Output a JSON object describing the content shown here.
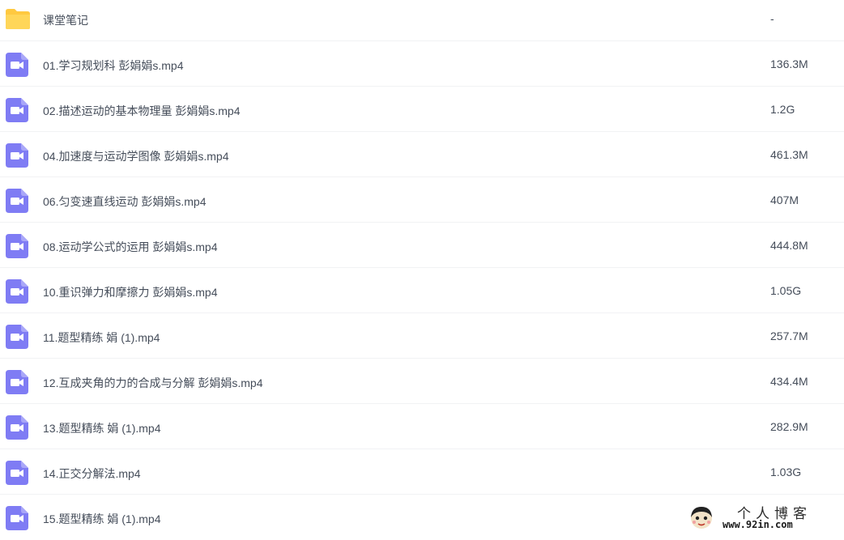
{
  "colors": {
    "folder_icon": "#ffd659",
    "video_icon": "#7f7cf4",
    "text": "#454d5a",
    "row_divider": "#f1f2f4"
  },
  "files": [
    {
      "type": "folder",
      "icon": "folder-icon",
      "name": "课堂笔记",
      "size": "-"
    },
    {
      "type": "video",
      "icon": "video-file-icon",
      "name": "01.学习规划科 彭娟娟s.mp4",
      "size": "136.3M"
    },
    {
      "type": "video",
      "icon": "video-file-icon",
      "name": "02.描述运动的基本物理量 彭娟娟s.mp4",
      "size": "1.2G"
    },
    {
      "type": "video",
      "icon": "video-file-icon",
      "name": "04.加速度与运动学图像 彭娟娟s.mp4",
      "size": "461.3M"
    },
    {
      "type": "video",
      "icon": "video-file-icon",
      "name": "06.匀变速直线运动 彭娟娟s.mp4",
      "size": "407M"
    },
    {
      "type": "video",
      "icon": "video-file-icon",
      "name": "08.运动学公式的运用 彭娟娟s.mp4",
      "size": "444.8M"
    },
    {
      "type": "video",
      "icon": "video-file-icon",
      "name": "10.重识弹力和摩擦力 彭娟娟s.mp4",
      "size": "1.05G"
    },
    {
      "type": "video",
      "icon": "video-file-icon",
      "name": "11.题型精练 娟 (1).mp4",
      "size": "257.7M"
    },
    {
      "type": "video",
      "icon": "video-file-icon",
      "name": "12.互成夹角的力的合成与分解 彭娟娟s.mp4",
      "size": "434.4M"
    },
    {
      "type": "video",
      "icon": "video-file-icon",
      "name": "13.题型精练 娟 (1).mp4",
      "size": "282.9M"
    },
    {
      "type": "video",
      "icon": "video-file-icon",
      "name": "14.正交分解法.mp4",
      "size": "1.03G"
    },
    {
      "type": "video",
      "icon": "video-file-icon",
      "name": "15.题型精练 娟 (1).mp4",
      "size": ""
    }
  ],
  "watermark": {
    "title": "个人博客",
    "url": "www.92in.com"
  }
}
